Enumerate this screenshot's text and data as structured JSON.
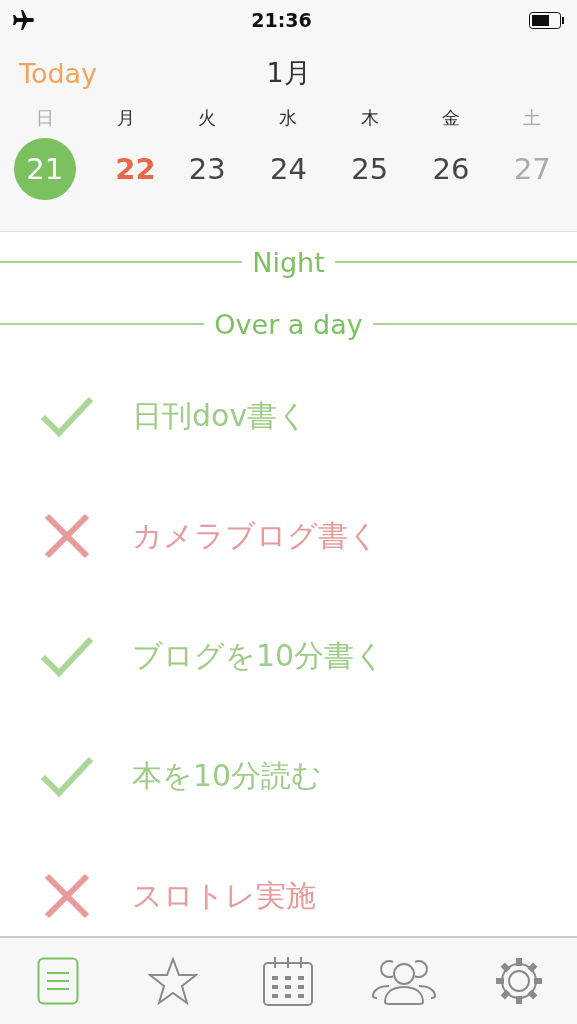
{
  "status_bar": {
    "time": "21:36"
  },
  "header": {
    "today_button": "Today",
    "month": "1月"
  },
  "days": [
    {
      "weekday": "日",
      "date": "21",
      "selected": true,
      "kind": "weekend"
    },
    {
      "weekday": "月",
      "date": "22",
      "selected": false,
      "kind": "today"
    },
    {
      "weekday": "火",
      "date": "23",
      "selected": false,
      "kind": "weekday"
    },
    {
      "weekday": "水",
      "date": "24",
      "selected": false,
      "kind": "weekday"
    },
    {
      "weekday": "木",
      "date": "25",
      "selected": false,
      "kind": "weekday"
    },
    {
      "weekday": "金",
      "date": "26",
      "selected": false,
      "kind": "weekday"
    },
    {
      "weekday": "土",
      "date": "27",
      "selected": false,
      "kind": "weekend"
    }
  ],
  "sections": [
    "Night",
    "Over a day"
  ],
  "tasks": [
    {
      "label": "日刊dov書く",
      "done": true
    },
    {
      "label": "カメラブログ書く",
      "done": false
    },
    {
      "label": "ブログを10分書く",
      "done": true
    },
    {
      "label": "本を10分読む",
      "done": true
    },
    {
      "label": "スロトレ実施",
      "done": false
    }
  ],
  "tab_bar": [
    {
      "kind": "list",
      "selected": true
    },
    {
      "kind": "star",
      "selected": false
    },
    {
      "kind": "calendar",
      "selected": false
    },
    {
      "kind": "people",
      "selected": false
    },
    {
      "kind": "settings",
      "selected": false
    }
  ]
}
